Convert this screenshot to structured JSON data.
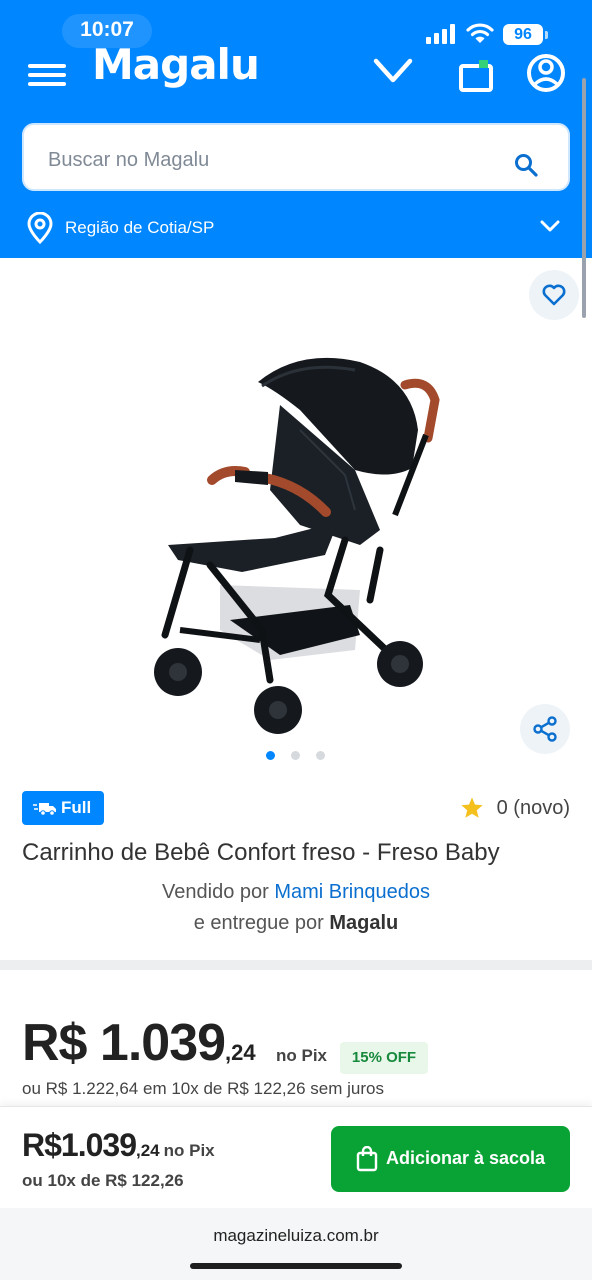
{
  "status_bar": {
    "time": "10:07",
    "battery": "96"
  },
  "header": {
    "logo": "Magalu",
    "search_placeholder": "Buscar no Magalu",
    "region": "Região de Cotia/SP",
    "icons": [
      "menu-icon",
      "chevron-down-icon",
      "bag-icon",
      "user-icon",
      "search-icon",
      "location-pin-icon"
    ]
  },
  "gallery": {
    "image_alt": "Carrinho de bebê preto com alças marrons",
    "dot_count": 3,
    "active_dot": 0
  },
  "product": {
    "badge": "Full",
    "rating": "0 (novo)",
    "title": "Carrinho de Bebê Confort freso - Freso Baby",
    "sold_by_prefix": "Vendido por",
    "seller": "Mami Brinquedos",
    "delivered_by_prefix": "e entregue por",
    "deliverer": "Magalu"
  },
  "price": {
    "integer": "R$ 1.039",
    "cents": ",24",
    "pix_label": "no Pix",
    "discount": "15% OFF",
    "installments": "ou R$ 1.222,64 em 10x de R$ 122,26 sem juros"
  },
  "sticky_bar": {
    "integer": "R$1.039",
    "cents": ",24",
    "pix_label": "no Pix",
    "installments": "ou 10x de R$ 122,26",
    "add_button": "Adicionar à sacola"
  },
  "browser": {
    "url": "magazineluiza.com.br"
  },
  "colors": {
    "brand_blue": "#0086ff",
    "cta_green": "#09a335",
    "discount_green": "#17893c",
    "link_blue": "#0b6fcf"
  }
}
